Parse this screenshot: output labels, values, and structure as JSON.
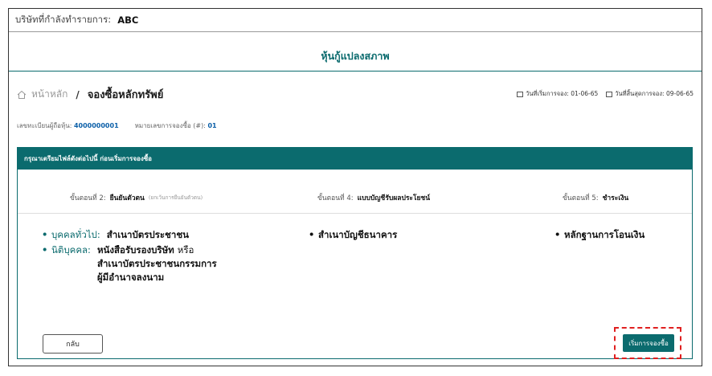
{
  "header": {
    "company_label": "บริษัทที่กำลังทำรายการ:",
    "company_value": "ABC"
  },
  "page": {
    "title": "หุ้นกู้แปลงสภาพ"
  },
  "breadcrumb": {
    "home": "หน้าหลัก",
    "separator": "/",
    "current": "จองซื้อหลักทรัพย์"
  },
  "dates": {
    "start": "วันที่เริ่มการจอง: 01-06-65",
    "end": "วันที่สิ้นสุดการจอง: 09-06-65"
  },
  "info": {
    "holder_label": "เลขทะเบียนผู้ถือหุ้น:",
    "holder_value": "4000000001",
    "ref_label": "หมายเลขการจองซื้อ (#):",
    "ref_value": "01"
  },
  "panel": {
    "heading": "กรุณาเตรียมไฟล์ดังต่อไปนี้ ก่อนเริ่มการจองซื้อ",
    "steps": [
      {
        "prefix": "ขั้นตอนที่ 2:",
        "name": "ยืนยันตัวตน",
        "note": "(ยกเว้นการยืนยันตัวตน)"
      },
      {
        "prefix": "ขั้นตอนที่ 4:",
        "name": "แบบบัญชีรับผลประโยชน์"
      },
      {
        "prefix": "ขั้นตอนที่ 5:",
        "name": "ชำระเงิน"
      }
    ],
    "col1": {
      "row1_label": "บุคคลทั่วไป:",
      "row1_text": "สำเนาบัตรประชาชน",
      "row2_label": "นิติบุคคล:",
      "row2_text_bold": "หนังสือรับรองบริษัท",
      "row2_text_or": "หรือ",
      "row2_text_line2": "สำเนาบัตรประชาชนกรรมการ",
      "row2_text_line3": "ผู้มีอำนาจลงนาม"
    },
    "col2": {
      "text": "สำเนาบัญชีธนาคาร"
    },
    "col3": {
      "text": "หลักฐานการโอนเงิน"
    },
    "bullet": "•"
  },
  "buttons": {
    "back": "กลับ",
    "start": "เริ่มการจองซื้อ"
  },
  "colors": {
    "accent": "#0b6b6e",
    "highlight": "#e02020",
    "link": "#0b5fa8"
  }
}
